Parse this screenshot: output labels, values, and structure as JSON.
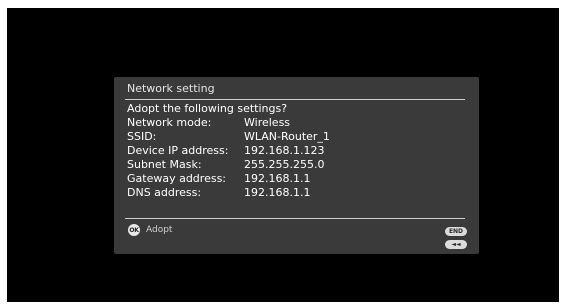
{
  "dialog": {
    "title": "Network setting",
    "prompt": "Adopt the following settings?",
    "rows": [
      {
        "label": "Network mode:",
        "value": "Wireless"
      },
      {
        "label": "SSID:",
        "value": "WLAN-Router_1"
      },
      {
        "label": "Device IP address:",
        "value": "192.168.1.123"
      },
      {
        "label": "Subnet Mask:",
        "value": "255.255.255.0"
      },
      {
        "label": "Gateway address:",
        "value": "192.168.1.1"
      },
      {
        "label": "DNS address:",
        "value": "192.168.1.1"
      }
    ],
    "ok_icon_text": "OK",
    "ok_label": "Adopt",
    "end_label": "END",
    "back_label": "◄◄"
  },
  "colors": {
    "screen_background": "#000000",
    "dialog_background": "#3a3a3a",
    "text": "#ffffff"
  }
}
